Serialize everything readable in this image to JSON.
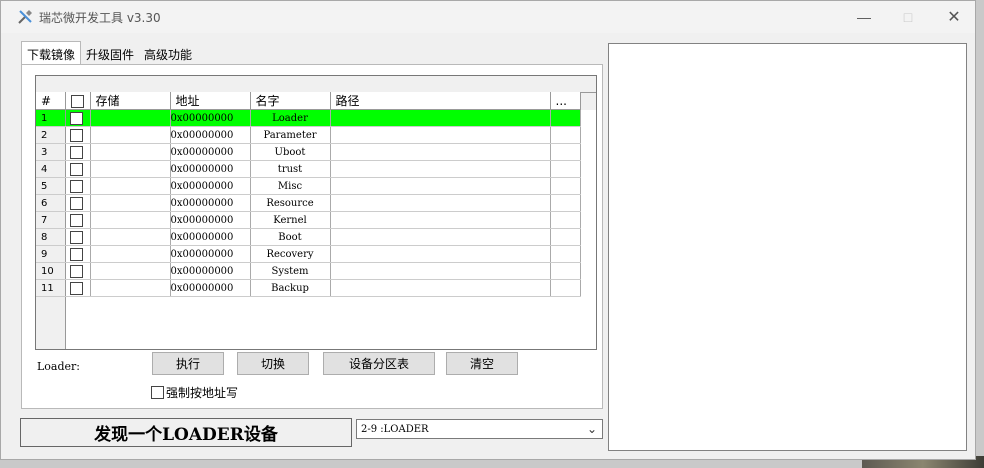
{
  "window": {
    "title": "瑞芯微开发工具 v3.30"
  },
  "tabs": [
    {
      "label": "下载镜像",
      "active": true
    },
    {
      "label": "升级固件",
      "active": false
    },
    {
      "label": "高级功能",
      "active": false
    }
  ],
  "grid": {
    "columns": {
      "num": "#",
      "storage": "存储",
      "address": "地址",
      "name": "名字",
      "path": "路径",
      "more": "..."
    },
    "rows": [
      {
        "num": "1",
        "address": "0x00000000",
        "name": "Loader",
        "selected": true
      },
      {
        "num": "2",
        "address": "0x00000000",
        "name": "Parameter"
      },
      {
        "num": "3",
        "address": "0x00000000",
        "name": "Uboot"
      },
      {
        "num": "4",
        "address": "0x00000000",
        "name": "trust"
      },
      {
        "num": "5",
        "address": "0x00000000",
        "name": "Misc"
      },
      {
        "num": "6",
        "address": "0x00000000",
        "name": "Resource"
      },
      {
        "num": "7",
        "address": "0x00000000",
        "name": "Kernel"
      },
      {
        "num": "8",
        "address": "0x00000000",
        "name": "Boot"
      },
      {
        "num": "9",
        "address": "0x00000000",
        "name": "Recovery"
      },
      {
        "num": "10",
        "address": "0x00000000",
        "name": "System"
      },
      {
        "num": "11",
        "address": "0x00000000",
        "name": "Backup"
      }
    ],
    "selected_color": "#00ff00"
  },
  "actions": {
    "loader_label": "Loader:",
    "run": "执行",
    "switch": "切换",
    "partition_table": "设备分区表",
    "clear": "清空",
    "force_by_address": "强制按地址写"
  },
  "status": {
    "message": "发现一个LOADER设备",
    "device_selected": "2-9 :LOADER"
  }
}
